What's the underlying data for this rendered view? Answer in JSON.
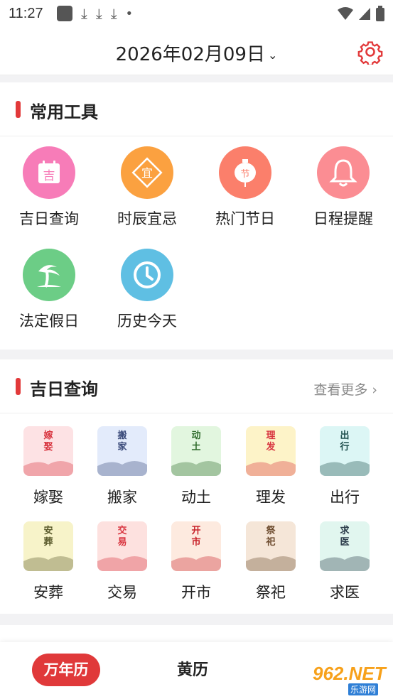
{
  "status": {
    "time": "11:27"
  },
  "header": {
    "date": "2026年02月09日",
    "dropdown_icon": "chevron-down-icon",
    "settings_icon": "gear-icon",
    "accent": "#e2393a"
  },
  "tools": {
    "title": "常用工具",
    "items": [
      {
        "label": "吉日查询",
        "icon": "calendar-icon",
        "glyph": "吉",
        "color": "#f77cb8"
      },
      {
        "label": "时辰宜忌",
        "icon": "diamond-icon",
        "glyph": "宜",
        "color": "#fba140"
      },
      {
        "label": "热门节日",
        "icon": "lantern-icon",
        "glyph": "节",
        "color": "#fb7f6b"
      },
      {
        "label": "日程提醒",
        "icon": "bell-icon",
        "glyph": "",
        "color": "#fb8d93"
      },
      {
        "label": "法定假日",
        "icon": "palm-tree-icon",
        "glyph": "",
        "color": "#6ccd86"
      },
      {
        "label": "历史今天",
        "icon": "clock-icon",
        "glyph": "",
        "color": "#5fbfe3"
      }
    ]
  },
  "jiri": {
    "title": "吉日查询",
    "more": "查看更多",
    "items": [
      {
        "label": "嫁娶",
        "cap": "嫁娶",
        "bg": "#fde2e4",
        "fg": "#d8343f"
      },
      {
        "label": "搬家",
        "cap": "搬家",
        "bg": "#e3ebfb",
        "fg": "#3a4a7a"
      },
      {
        "label": "动土",
        "cap": "动土",
        "bg": "#e2f6df",
        "fg": "#2f6b2c"
      },
      {
        "label": "理发",
        "cap": "理发",
        "bg": "#fdf3c8",
        "fg": "#d8343f"
      },
      {
        "label": "出行",
        "cap": "出行",
        "bg": "#dcf6f5",
        "fg": "#1d4d4b"
      },
      {
        "label": "安葬",
        "cap": "安葬",
        "bg": "#f7f3c9",
        "fg": "#5a5a2c"
      },
      {
        "label": "交易",
        "cap": "交易",
        "bg": "#fde1df",
        "fg": "#d8343f"
      },
      {
        "label": "开市",
        "cap": "开市",
        "bg": "#fdeadf",
        "fg": "#c8232b"
      },
      {
        "label": "祭祀",
        "cap": "祭祀",
        "bg": "#f5e6d8",
        "fg": "#6b4a2d"
      },
      {
        "label": "求医",
        "cap": "求医",
        "bg": "#e1f6ef",
        "fg": "#2b3c4a"
      }
    ]
  },
  "tabs": [
    {
      "label": "万年历",
      "active": true
    },
    {
      "label": "黄历",
      "active": false
    }
  ],
  "watermark": {
    "text": "962.NET",
    "sub": "乐游网"
  }
}
